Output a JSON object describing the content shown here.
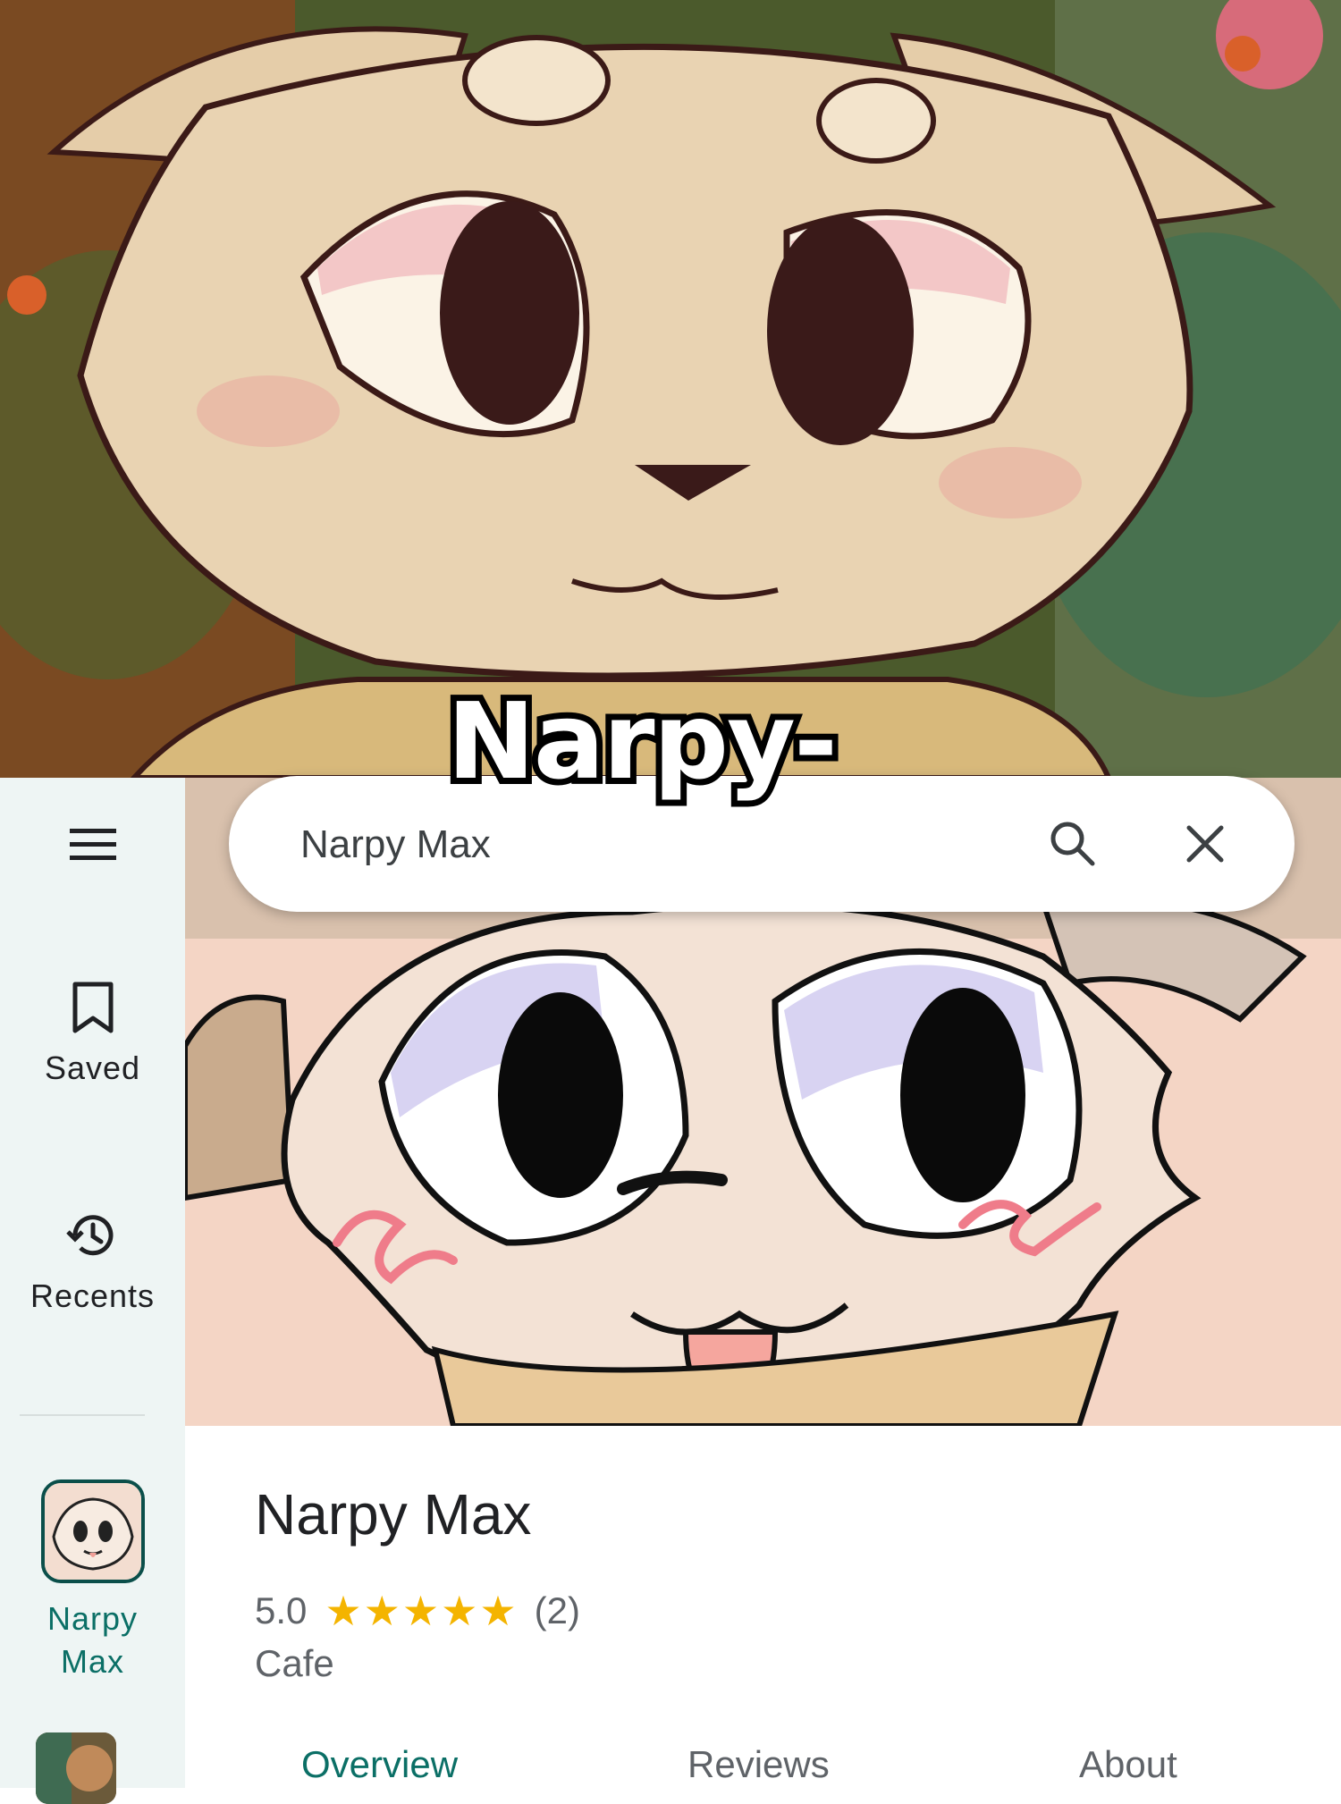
{
  "caption": "Narpy-",
  "search": {
    "value": "Narpy Max"
  },
  "rail": {
    "saved_label": "Saved",
    "recents_label": "Recents",
    "place_label_line1": "Narpy",
    "place_label_line2": "Max"
  },
  "place": {
    "title": "Narpy Max",
    "rating": "5.0",
    "stars": "★★★★★",
    "review_count": "(2)",
    "category": "Cafe"
  },
  "tabs": [
    "Overview",
    "Reviews",
    "About"
  ],
  "colors": {
    "accent": "#0b6f66",
    "star": "#f4b400",
    "rail_bg": "#eef5f4"
  },
  "icons": {
    "menu": "menu-icon",
    "saved": "bookmark-icon",
    "recents": "history-icon",
    "search": "search-icon",
    "clear": "close-icon"
  }
}
